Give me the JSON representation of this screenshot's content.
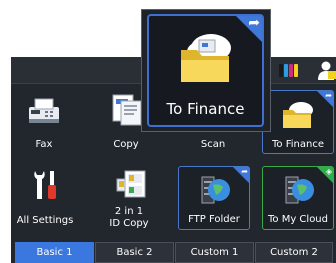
{
  "popup": {
    "label": "To Finance",
    "icon": "folder-cloud-icon",
    "badge": "share-arrow-icon"
  },
  "status": {
    "ink_colors": [
      "#1a1a1a",
      "#2c9ee0",
      "#d02a8a",
      "#f2d21c"
    ],
    "user_icon": "user-icon"
  },
  "tiles": {
    "fax": "Fax",
    "copy": "Copy",
    "scan": "Scan",
    "to_finance": "To Finance",
    "all_settings": "All Settings",
    "two_in_one_line1": "2 in 1",
    "two_in_one_line2": "ID Copy",
    "ftp_folder": "FTP Folder",
    "to_my_cloud": "To My Cloud"
  },
  "tabs": [
    "Basic 1",
    "Basic 2",
    "Custom 1",
    "Custom 2"
  ],
  "active_tab": "Basic 1",
  "colors": {
    "accent_blue": "#3a78e0",
    "accent_green": "#2fae4a",
    "panel": "#22262d"
  }
}
